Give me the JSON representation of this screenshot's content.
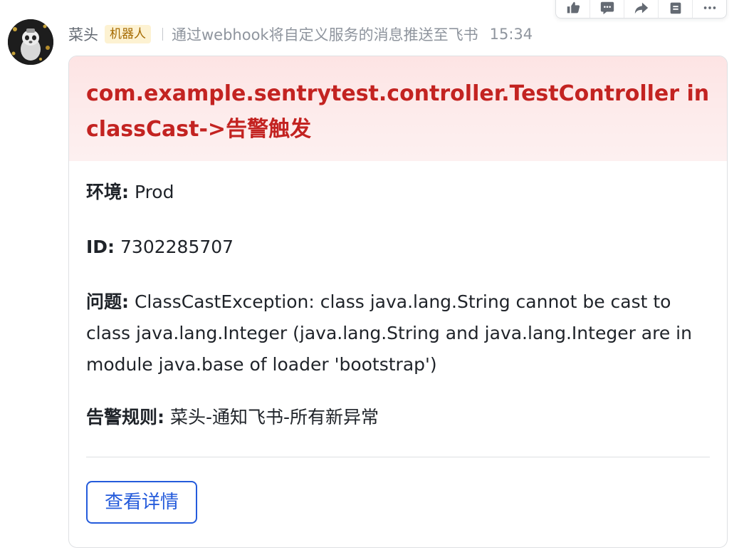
{
  "toolbar": {
    "icons": [
      "thumbs-up-icon",
      "comment-icon",
      "forward-icon",
      "pin-icon",
      "more-icon"
    ]
  },
  "message": {
    "sender": "菜头",
    "badge": "机器人",
    "description": "通过webhook将自定义服务的消息推送至飞书",
    "time": "15:34"
  },
  "card": {
    "title": "com.example.sentrytest.controller.TestController in classCast->告警触发",
    "header_color": "#fde4e4",
    "title_color": "#c32321",
    "fields": {
      "env_label": "环境:",
      "env_value": " Prod",
      "id_label": "ID:",
      "id_value": " 7302285707",
      "problem_label": "问题:",
      "problem_value": " ClassCastException: class java.lang.String cannot be cast to class java.lang.Integer (java.lang.String and java.lang.Integer are in module java.base of loader 'bootstrap')",
      "rule_label": "告警规则:",
      "rule_value": " 菜头-通知飞书-所有新异常"
    },
    "button_label": "查看详情",
    "button_color": "#245bdb"
  }
}
